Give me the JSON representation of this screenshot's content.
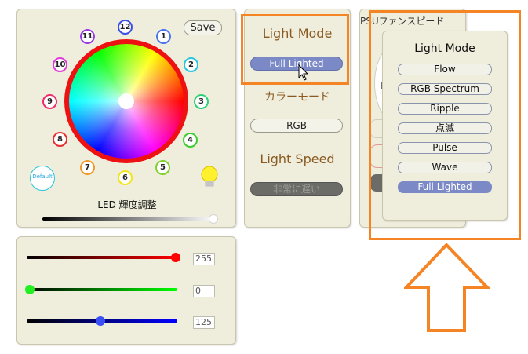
{
  "color_panel": {
    "save_label": "Save",
    "numbers": [
      "1",
      "2",
      "3",
      "4",
      "5",
      "6",
      "7",
      "8",
      "9",
      "10",
      "11",
      "12"
    ],
    "default_label": "Default",
    "brightness_label": "LED 輝度調整",
    "brightness_level": 0.9
  },
  "rgb_panel": {
    "red_value": "255",
    "green_value": "0",
    "blue_value": "125"
  },
  "mode_panel": {
    "light_mode_title": "Light Mode",
    "current_mode": "Full Lighted",
    "color_mode_title": "カラーモード",
    "color_mode_value": "RGB",
    "light_speed_title": "Light Speed",
    "light_speed_value": "非常に遅い"
  },
  "psu_panel": {
    "title": "PSUファンスピード",
    "fragment_l": "L"
  },
  "popup": {
    "title": "Light Mode",
    "items": [
      "Flow",
      "RGB Spectrum",
      "Ripple",
      "点滅",
      "Pulse",
      "Wave",
      "Full Lighted"
    ],
    "selected_index": 6
  },
  "colors": {
    "annotation_orange": "#f58524",
    "selected_fill": "#7b8ac6",
    "ring_red": "#ee1111"
  }
}
